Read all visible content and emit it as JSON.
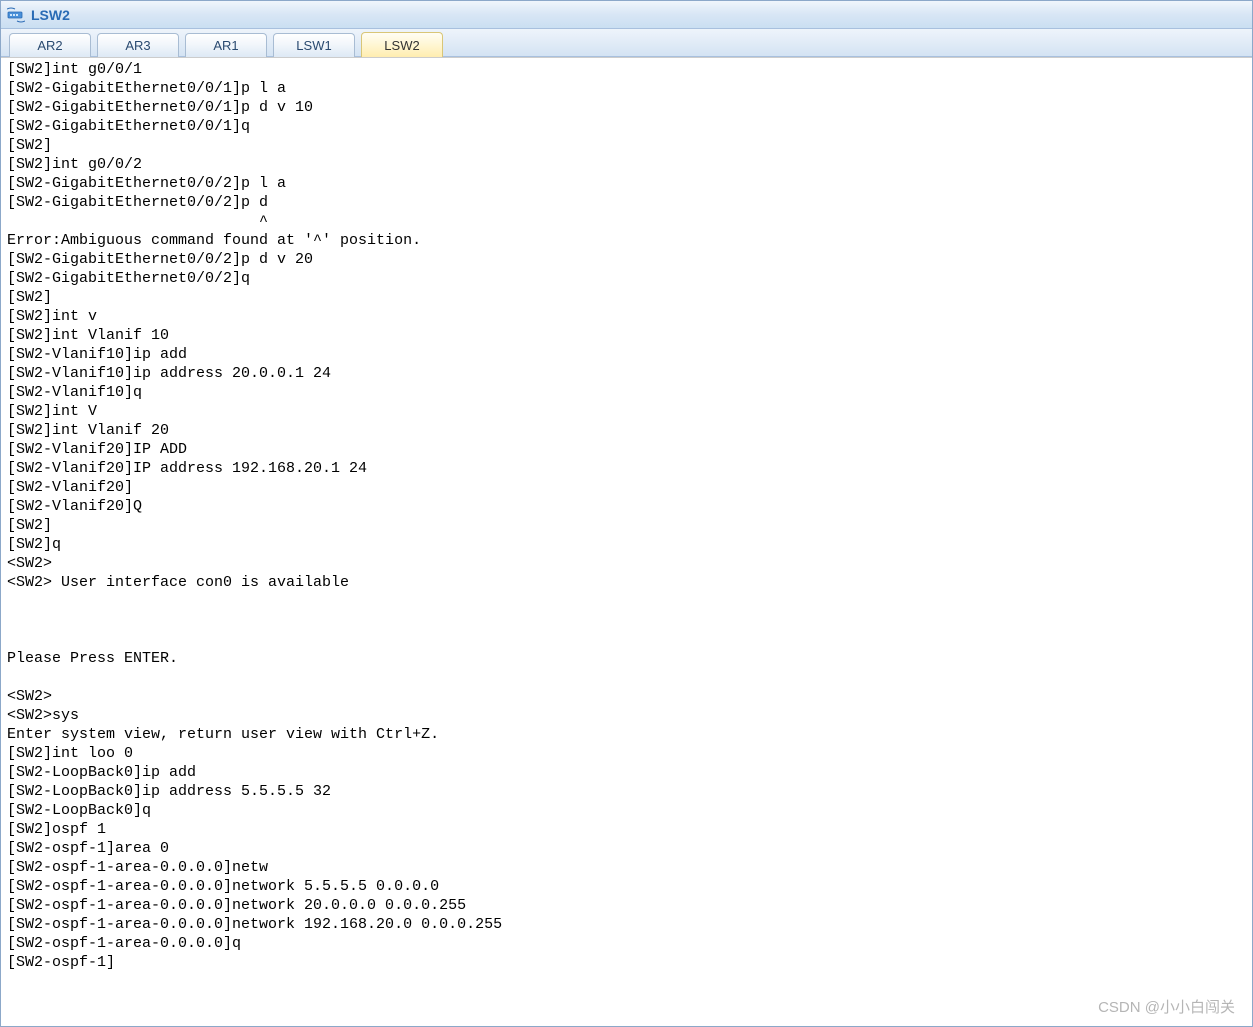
{
  "window": {
    "title": "LSW2"
  },
  "tabs": [
    {
      "label": "AR2",
      "active": false
    },
    {
      "label": "AR3",
      "active": false
    },
    {
      "label": "AR1",
      "active": false
    },
    {
      "label": "LSW1",
      "active": false
    },
    {
      "label": "LSW2",
      "active": true
    }
  ],
  "terminal": {
    "lines": [
      "[SW2]int g0/0/1",
      "[SW2-GigabitEthernet0/0/1]p l a",
      "[SW2-GigabitEthernet0/0/1]p d v 10",
      "[SW2-GigabitEthernet0/0/1]q",
      "[SW2]",
      "[SW2]int g0/0/2",
      "[SW2-GigabitEthernet0/0/2]p l a",
      "[SW2-GigabitEthernet0/0/2]p d",
      "                            ^",
      "Error:Ambiguous command found at '^' position.",
      "[SW2-GigabitEthernet0/0/2]p d v 20",
      "[SW2-GigabitEthernet0/0/2]q",
      "[SW2]",
      "[SW2]int v",
      "[SW2]int Vlanif 10",
      "[SW2-Vlanif10]ip add",
      "[SW2-Vlanif10]ip address 20.0.0.1 24",
      "[SW2-Vlanif10]q",
      "[SW2]int V",
      "[SW2]int Vlanif 20",
      "[SW2-Vlanif20]IP ADD",
      "[SW2-Vlanif20]IP address 192.168.20.1 24",
      "[SW2-Vlanif20]",
      "[SW2-Vlanif20]Q",
      "[SW2]",
      "[SW2]q",
      "<SW2>",
      "<SW2> User interface con0 is available",
      "",
      "",
      "",
      "Please Press ENTER.",
      "",
      "<SW2>",
      "<SW2>sys",
      "Enter system view, return user view with Ctrl+Z.",
      "[SW2]int loo 0",
      "[SW2-LoopBack0]ip add",
      "[SW2-LoopBack0]ip address 5.5.5.5 32",
      "[SW2-LoopBack0]q",
      "[SW2]ospf 1",
      "[SW2-ospf-1]area 0",
      "[SW2-ospf-1-area-0.0.0.0]netw",
      "[SW2-ospf-1-area-0.0.0.0]network 5.5.5.5 0.0.0.0",
      "[SW2-ospf-1-area-0.0.0.0]network 20.0.0.0 0.0.0.255",
      "[SW2-ospf-1-area-0.0.0.0]network 192.168.20.0 0.0.0.255",
      "[SW2-ospf-1-area-0.0.0.0]q",
      "[SW2-ospf-1]"
    ]
  },
  "watermark": "CSDN @小小白闯关"
}
